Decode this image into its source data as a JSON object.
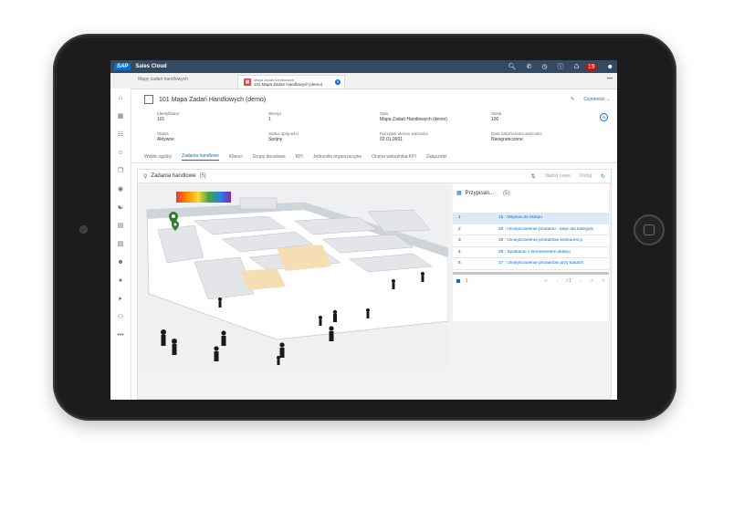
{
  "shell": {
    "logo": "SAP",
    "app_title": "Sales Cloud",
    "notification_count": "19",
    "icons": [
      "search-icon",
      "phone-icon",
      "clock-icon",
      "help-icon",
      "bell-icon",
      "user-icon"
    ]
  },
  "tabs": {
    "first": "Mapy zadań handlowych",
    "active_sub": "Mapa zadań handlowych",
    "active_main": "101 Mapa Zadań Handlowych (demo)",
    "more": "•••"
  },
  "sidenav": {
    "icons": [
      "home-icon",
      "calendar-icon",
      "feed-icon",
      "people-icon",
      "copy-icon",
      "search-people-icon",
      "team-icon",
      "document-icon",
      "document2-icon",
      "contacts-icon",
      "person-icon",
      "megaphone-icon",
      "group-icon"
    ],
    "more": "•••"
  },
  "header": {
    "title": "101 Mapa Zadań Handlowych (demo)",
    "actions_label": "Czynności",
    "fields": {
      "id_label": "Identyfikator",
      "id_value": "101",
      "version_label": "Wersja",
      "version_value": "1",
      "desc_label": "Opis",
      "desc_value": "Mapa Zadań Handlowych (demo)",
      "share_label": "Skala",
      "share_value": "100",
      "status_label": "Status",
      "status_value": "Aktywne",
      "consistency_label": "Status spójności",
      "consistency_value": "Spójny",
      "start_label": "Początek okresu ważności",
      "start_value": "02.01.0001",
      "end_label": "Data zakończenia ważności",
      "end_value": "Nieograniczone"
    }
  },
  "subtabs": [
    "Widok ogólny",
    "Zadania handlowe",
    "Klienci",
    "Grupy docelowe",
    "KPI",
    "Jednostki organizacyjne",
    "Ocena wskaźnika KPI",
    "Załączniki"
  ],
  "panel": {
    "title": "Zadania handlowe",
    "count": "(5)",
    "tool_new": "Ułaśnij nowe",
    "tool_add": "Dodaj"
  },
  "assigned": {
    "title": "Przypisan...",
    "count": "(5)",
    "rows": [
      {
        "num": "1",
        "text": "15 : Wejście do sklepu"
      },
      {
        "num": "2",
        "text": "26 : Umiejscowienie produktu - aleje dla kategorii"
      },
      {
        "num": "3",
        "text": "28 : Umiejscowienie produktów konkurencji"
      },
      {
        "num": "4",
        "text": "29 : Spotkanie z kierownikiem sklepu"
      },
      {
        "num": "5",
        "text": "27 : Umiejscowienie produktów przy kasach"
      }
    ],
    "page": "1",
    "page_total": "/ 1"
  },
  "colors": {
    "shell": "#354a5f",
    "accent": "#0a6ed1",
    "selected_row": "#dce9f7"
  }
}
